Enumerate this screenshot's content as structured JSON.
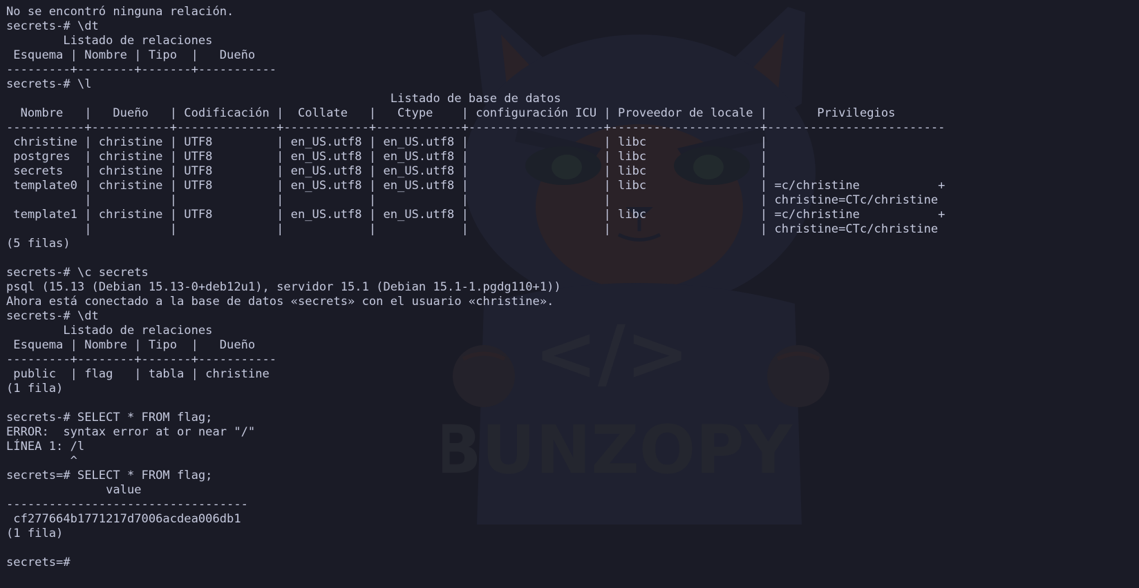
{
  "terminal": {
    "background": "#1a1b26",
    "foreground": "#c5c9de",
    "lines": [
      "No se encontró ninguna relación.",
      "secrets-# \\dt",
      "        Listado de relaciones",
      " Esquema | Nombre | Tipo  |   Dueño",
      "---------+--------+-------+-----------",
      "secrets-# \\l",
      "                                                      Listado de base de datos",
      "  Nombre   |   Dueño   | Codificación |  Collate   |   Ctype    | configuración ICU | Proveedor de locale |       Privilegios",
      "-----------+-----------+--------------+------------+------------+-------------------+---------------------+-------------------------",
      " christine | christine | UTF8         | en_US.utf8 | en_US.utf8 |                   | libc                |",
      " postgres  | christine | UTF8         | en_US.utf8 | en_US.utf8 |                   | libc                |",
      " secrets   | christine | UTF8         | en_US.utf8 | en_US.utf8 |                   | libc                |",
      " template0 | christine | UTF8         | en_US.utf8 | en_US.utf8 |                   | libc                | =c/christine           +",
      "           |           |              |            |            |                   |                     | christine=CTc/christine",
      " template1 | christine | UTF8         | en_US.utf8 | en_US.utf8 |                   | libc                | =c/christine           +",
      "           |           |              |            |            |                   |                     | christine=CTc/christine",
      "(5 filas)",
      "",
      "secrets-# \\c secrets",
      "psql (15.13 (Debian 15.13-0+deb12u1), servidor 15.1 (Debian 15.1-1.pgdg110+1))",
      "Ahora está conectado a la base de datos «secrets» con el usuario «christine».",
      "secrets-# \\dt",
      "        Listado de relaciones",
      " Esquema | Nombre | Tipo  |   Dueño",
      "---------+--------+-------+-----------",
      " public  | flag   | tabla | christine",
      "(1 fila)",
      "",
      "secrets-# SELECT * FROM flag;",
      "ERROR:  syntax error at or near \"/\"",
      "LÍNEA 1: /l",
      "         ^",
      "secrets=# SELECT * FROM flag;",
      "              value",
      "----------------------------------",
      " cf277664b1771217d7006acdea006db1",
      "(1 fila)",
      "",
      "secrets=#"
    ],
    "wallpaper_text": "BUNZOPY",
    "wallpaper_code_symbol": "</>"
  }
}
